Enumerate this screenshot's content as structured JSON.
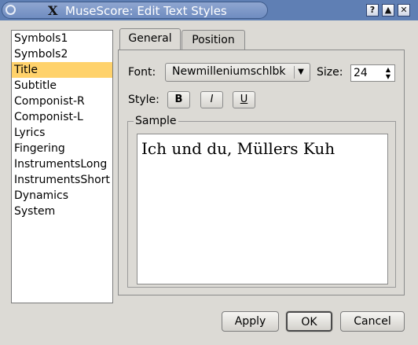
{
  "window": {
    "title": "MuseScore: Edit Text Styles",
    "titlebar_buttons": [
      "help-icon",
      "shade-icon",
      "close-icon"
    ]
  },
  "styles_list": {
    "items": [
      "Symbols1",
      "Symbols2",
      "Title",
      "Subtitle",
      "Componist-R",
      "Componist-L",
      "Lyrics",
      "Fingering",
      "InstrumentsLong",
      "InstrumentsShort",
      "Dynamics",
      "System"
    ],
    "selected": "Title",
    "selected_color": "#ffd26b"
  },
  "tabs": [
    {
      "label": "General",
      "active": true
    },
    {
      "label": "Position",
      "active": false
    }
  ],
  "general": {
    "font_label": "Font:",
    "font_value": "Newmilleniumschlbk",
    "size_label": "Size:",
    "size_value": "24",
    "style_label": "Style:",
    "bold_label": "B",
    "italic_label": "I",
    "underline_label": "U",
    "sample_group_label": "Sample",
    "sample_text": "Ich und du, Müllers Kuh"
  },
  "buttons": {
    "apply": "Apply",
    "ok": "OK",
    "cancel": "Cancel"
  }
}
